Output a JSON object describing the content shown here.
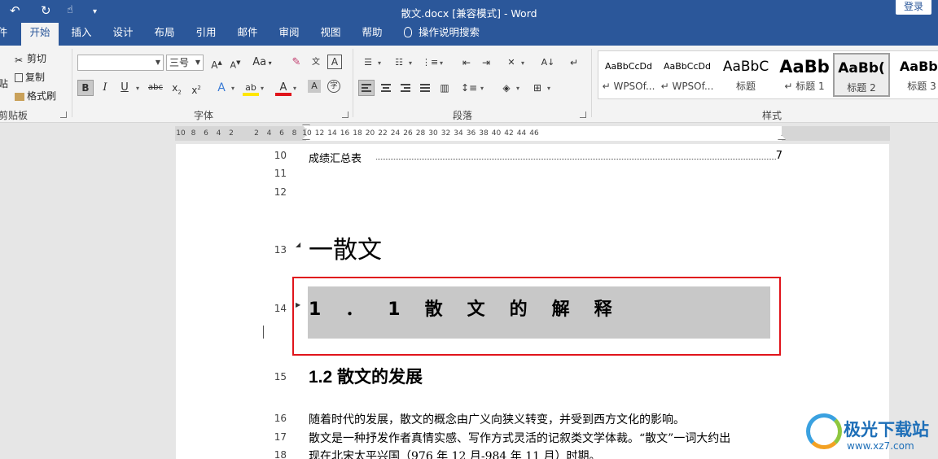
{
  "window": {
    "title": "散文.docx [兼容模式]  -  Word",
    "login_label": "登录",
    "qat_icons": [
      "undo-icon",
      "redo-icon",
      "touch-mode-icon",
      "customize-qat-icon"
    ]
  },
  "tabs": [
    {
      "label": "件"
    },
    {
      "label": "开始",
      "active": true
    },
    {
      "label": "插入"
    },
    {
      "label": "设计"
    },
    {
      "label": "布局"
    },
    {
      "label": "引用"
    },
    {
      "label": "邮件"
    },
    {
      "label": "审阅"
    },
    {
      "label": "视图"
    },
    {
      "label": "帮助"
    },
    {
      "label": "操作说明搜索"
    }
  ],
  "ribbon": {
    "clipboard": {
      "cut": "剪切",
      "copy": "复制",
      "format_painter": "格式刷",
      "paste_fragment": "贴",
      "group_label": "剪贴板"
    },
    "font": {
      "font_name": "",
      "font_size": "三号",
      "aa": "Aa",
      "group_label": "字体"
    },
    "paragraph": {
      "group_label": "段落"
    },
    "styles": {
      "group_label": "样式",
      "items": [
        {
          "preview": "AaBbCcDd",
          "name": "↵ WPSOf..."
        },
        {
          "preview": "AaBbCcDd",
          "name": "↵ WPSOf..."
        },
        {
          "preview": "AaBbC",
          "name": "标题"
        },
        {
          "preview": "AaBb",
          "name": "↵ 标题 1"
        },
        {
          "preview": "AaBb(",
          "name": "标题 2",
          "selected": true
        },
        {
          "preview": "AaBb(",
          "name": "标题 3"
        }
      ]
    }
  },
  "ruler": {
    "ticks": [
      "10",
      "8",
      "6",
      "4",
      "2",
      "",
      "2",
      "4",
      "6",
      "8",
      "10",
      "12",
      "14",
      "16",
      "18",
      "20",
      "22",
      "24",
      "26",
      "28",
      "30",
      "32",
      "34",
      "36",
      "38",
      "40",
      "42",
      "44",
      "46"
    ]
  },
  "document": {
    "line_numbers": [
      "10",
      "11",
      "12",
      "13",
      "14",
      "15",
      "16",
      "17",
      "18"
    ],
    "toc_entry": {
      "text": "成绩汇总表",
      "page": "7"
    },
    "heading1": "一散文",
    "heading2_selected": "1．1散文的解释",
    "heading2_next": "1.2 散文的发展",
    "body": [
      "随着时代的发展，散文的概念由广义向狭义转变，并受到西方文化的影响。",
      "散文是一种抒发作者真情实感、写作方式灵活的记叙类文学体裁。“散文”一词大约出",
      "现在北宋太平兴国（976 年 12 月-984 年 11 月）时期。"
    ]
  },
  "watermark": {
    "brand": "极光下载站",
    "url": "www.xz7.com"
  }
}
